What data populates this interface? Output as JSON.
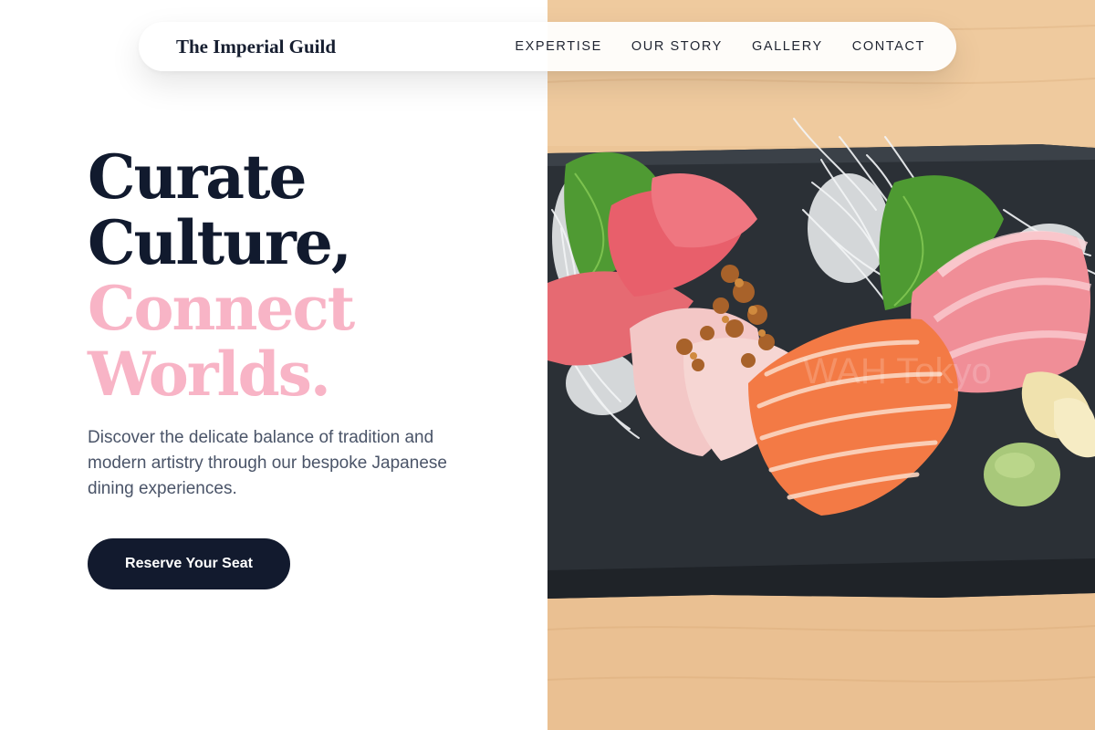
{
  "nav": {
    "brand": "The Imperial Guild",
    "links": [
      "EXPERTISE",
      "OUR STORY",
      "GALLERY",
      "CONTACT"
    ]
  },
  "hero": {
    "headline_dark": [
      "Curate",
      "Culture,"
    ],
    "headline_accent": [
      "Connect",
      "Worlds."
    ],
    "description": "Discover the delicate balance of tradition and modern artistry through our bespoke Japanese dining experiences.",
    "cta_label": "Reserve Your Seat"
  },
  "image": {
    "subject": "sashimi-platter-photo",
    "watermark": "WAH Tokyo"
  },
  "colors": {
    "dark_navy": "#111a2e",
    "accent_pink": "#f8b4c6",
    "body_text": "#4a5468",
    "wood": "#ecc597",
    "slate": "#2b3036"
  }
}
